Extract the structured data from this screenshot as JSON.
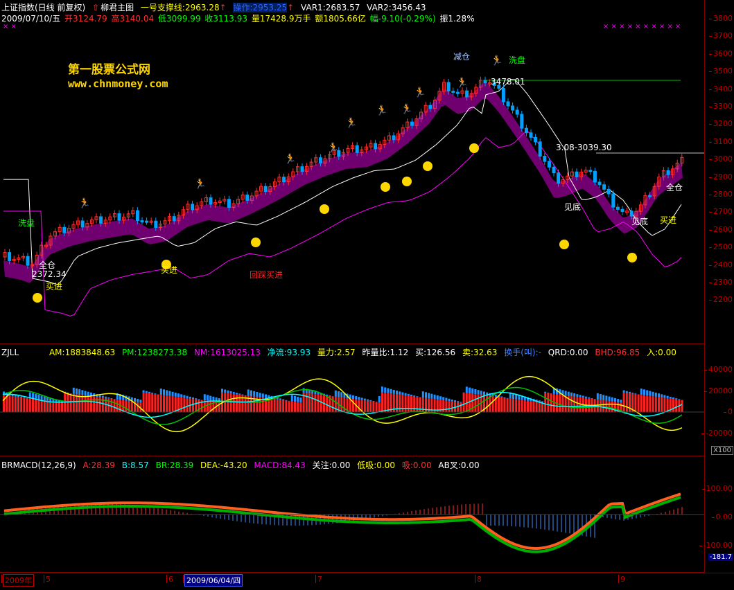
{
  "main": {
    "header1": {
      "index_name": "上证指数(日线 前复权)",
      "formula": "柳君主图",
      "support": "一号支撑线:2963.28",
      "operate": "操作:2953.25",
      "var1": "VAR1:2683.57",
      "var2": "VAR2:3456.43"
    },
    "header2": {
      "date": "2009/07/10/五",
      "open": "开3124.79",
      "high": "高3140.04",
      "low": "低3099.99",
      "close": "收3113.93",
      "volume": "量17428.9万手",
      "amount": "额1805.66亿",
      "change": "幅-9.10(-0.29%)",
      "amplitude": "振1.28%"
    },
    "watermark_name": "第一股票公式网",
    "watermark_url": "www.chnmoney.com",
    "axis_ticks": [
      "3800",
      "3700",
      "3600",
      "3500",
      "3400",
      "3300",
      "3200",
      "3100",
      "3000",
      "2900",
      "2800",
      "2700",
      "2600",
      "2500",
      "2400",
      "2300",
      "2200"
    ],
    "annotations": {
      "wash1": "洗盘",
      "full1": "全仓",
      "buy1": "买进",
      "low_value": "2372.34",
      "buy2": "买进",
      "pullback_buy": "回踩买进",
      "reduce": "减仓",
      "wash2": "洗盘",
      "high_value": "3478.01",
      "range_value": "3.08-3039.30",
      "bottom1": "见底",
      "bottom2": "见底",
      "buy3": "买进",
      "full2": "全仓"
    },
    "colors": {
      "up": "#ff3030",
      "down": "#00a0ff",
      "pink": "#ff00ff",
      "white": "#ffffff",
      "gold": "#ffd700",
      "green": "#00c000",
      "teal": "#1e90ff"
    }
  },
  "zjll": {
    "name": "ZJLL",
    "am": "AM:1883848.63",
    "pm": "PM:1238273.38",
    "nm": "NM:1613025.13",
    "net": "净流:93.93",
    "power": "量力:2.57",
    "ratio": "昨量比:1.12",
    "buy": "买:126.56",
    "sell": "卖:32.63",
    "turnover": "换手(叫):-",
    "qrd": "QRD:0.00",
    "bhd": "BHD:96.85",
    "enter": "入:0.00",
    "axis_ticks": [
      "40000",
      "20000",
      "0",
      "-20000"
    ],
    "unit": "X100"
  },
  "brmacd": {
    "name": "BRMACD(12,26,9)",
    "a": "A:28.39",
    "b": "B:8.57",
    "br": "BR:28.39",
    "dea": "DEA:-43.20",
    "macd": "MACD:84.43",
    "focus": "关注:0.00",
    "low_suck": "低吸:0.00",
    "suck": "吸:0.00",
    "ab_cross": "AB叉:0.00",
    "axis_ticks": [
      "100.00",
      "0.00",
      "-100.00"
    ],
    "current": "-181.7"
  },
  "timebar": {
    "year": "2009年",
    "m5": "5",
    "m6": "6",
    "cursor_date": "2009/06/04/四",
    "m7": "7",
    "m8": "8",
    "m9": "9"
  }
}
